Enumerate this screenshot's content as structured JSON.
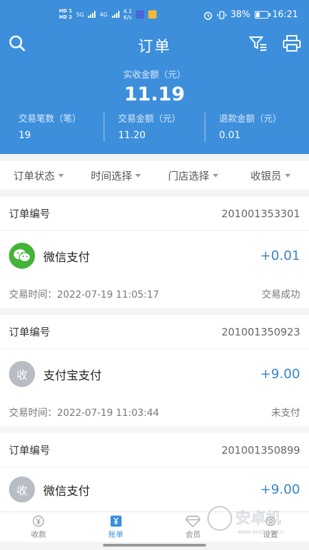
{
  "status_bar": {
    "sim1": "HD 1",
    "sim2": "HD 2",
    "network": "5G",
    "network2": "4G",
    "speed_value": "4.1",
    "speed_unit": "K/s",
    "battery_percent": "38%",
    "battery_level": 0.38,
    "time": "16:21"
  },
  "header": {
    "title": "订单",
    "summary_label": "实收金额（元）",
    "summary_value": "11.19",
    "stats": [
      {
        "label": "交易笔数（笔）",
        "value": "19"
      },
      {
        "label": "交易金额（元）",
        "value": "11.20"
      },
      {
        "label": "退款金额（元）",
        "value": "0.01"
      }
    ]
  },
  "filters": [
    "订单状态",
    "时间选择",
    "门店选择",
    "收银员"
  ],
  "orders": [
    {
      "label": "订单编号",
      "number": "201001353301",
      "icon": "wechat-icon",
      "method": "微信支付",
      "amount": "+0.01",
      "time": "交易时间：2022-07-19 11:05:17",
      "status": "交易成功"
    },
    {
      "label": "订单编号",
      "number": "201001350923",
      "icon": "shou-icon",
      "icon_text": "收",
      "method": "支付宝支付",
      "amount": "+9.00",
      "time": "交易时间：2022-07-19 11:03:44",
      "status": "未支付"
    },
    {
      "label": "订单编号",
      "number": "201001350899",
      "icon": "shou-icon",
      "icon_text": "收",
      "method": "微信支付",
      "amount": "+9.00"
    }
  ],
  "tabs": [
    {
      "label": "收款",
      "icon": "yuan-coin-icon"
    },
    {
      "label": "账单",
      "icon": "bill-icon",
      "active": true
    },
    {
      "label": "会员",
      "icon": "diamond-icon"
    },
    {
      "label": "设置",
      "icon": "gear-icon"
    }
  ],
  "watermark": {
    "text": "安卓机",
    "sub": "www.anzhuoji.cn"
  },
  "colors": {
    "primary": "#3d8fdc",
    "wechat": "#43b437",
    "amount": "#3b86c6"
  }
}
